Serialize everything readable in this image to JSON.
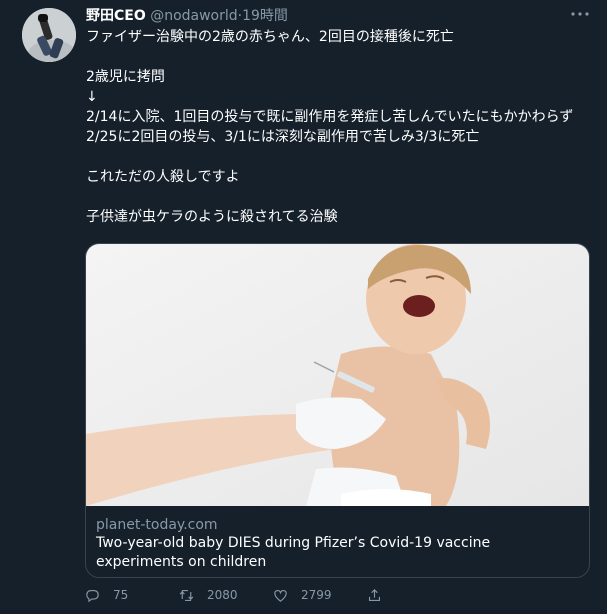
{
  "tweet": {
    "display_name": "野田CEO",
    "handle": "@nodaworld",
    "separator": "·",
    "time": "19時間",
    "lines": [
      "ファイザー治験中の2歳の赤ちゃん、2回目の接種後に死亡",
      "2歳児に拷問",
      "↓",
      "2/14に入院、1回目の投与で既に副作用を発症し苦しんでいたにもかかわらず",
      "2/25に2回目の投与、3/1には深刻な副作用で苦しみ3/3に死亡",
      "これただの人殺しですよ",
      "子供達が虫ケラのように殺されてる治験"
    ]
  },
  "card": {
    "domain": "planet-today.com",
    "title": "Two-year-old baby DIES during Pfizer’s Covid-19 vaccine experiments on children"
  },
  "actions": {
    "reply_count": "75",
    "retweet_count": "2080",
    "like_count": "2799"
  },
  "icons": {
    "more": "more-icon",
    "reply": "reply-icon",
    "retweet": "retweet-icon",
    "like": "like-icon",
    "share": "share-icon"
  },
  "colors": {
    "background": "#15202b",
    "secondary_text": "#8899a6",
    "border": "#38444d"
  }
}
